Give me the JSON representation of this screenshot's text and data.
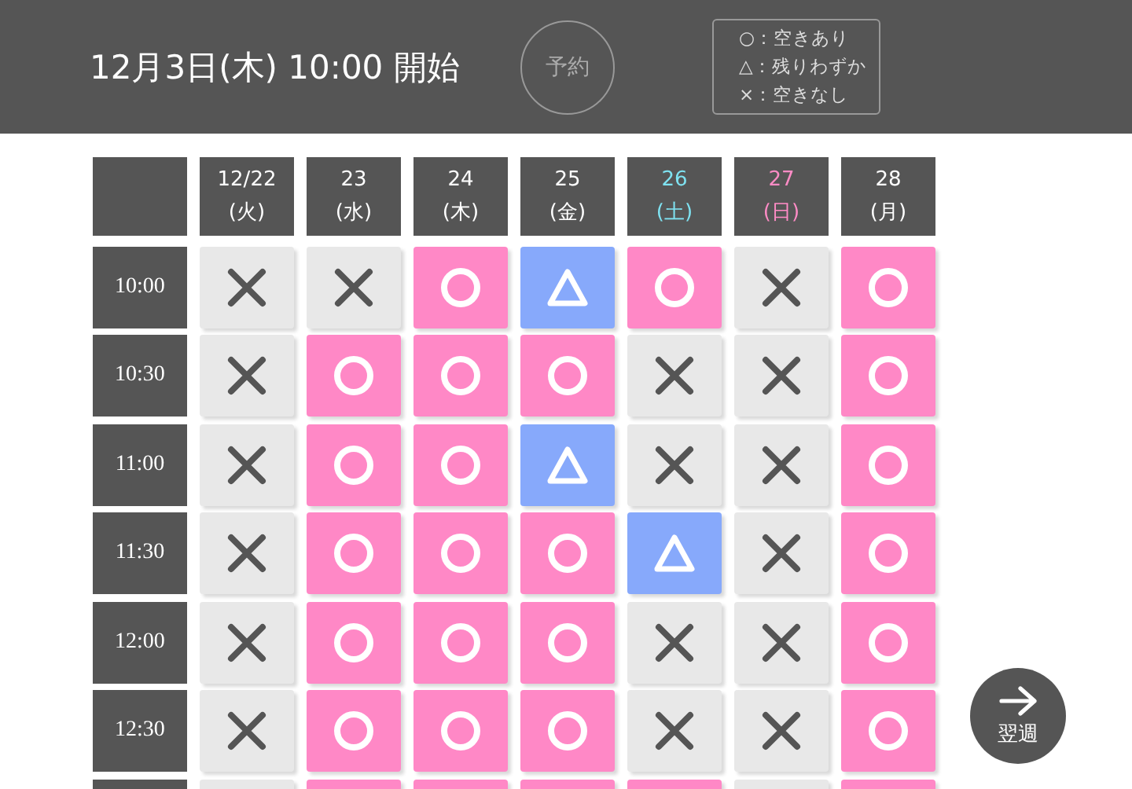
{
  "header": {
    "title": "12月3日(木) 10:00 開始",
    "reserve_button": "予約",
    "legend": [
      "○：空きあり",
      "△：残りわずか",
      "×：空きなし"
    ]
  },
  "days": [
    {
      "date": "12/22",
      "weekday": "(火)",
      "kind": "weekday"
    },
    {
      "date": "23",
      "weekday": "(水)",
      "kind": "weekday"
    },
    {
      "date": "24",
      "weekday": "(木)",
      "kind": "weekday"
    },
    {
      "date": "25",
      "weekday": "(金)",
      "kind": "weekday"
    },
    {
      "date": "26",
      "weekday": "(土)",
      "kind": "saturday"
    },
    {
      "date": "27",
      "weekday": "(日)",
      "kind": "sunday"
    },
    {
      "date": "28",
      "weekday": "(月)",
      "kind": "weekday"
    }
  ],
  "rows": [
    {
      "time": "10:00",
      "slots": [
        {
          "kind": "full"
        },
        {
          "kind": "full"
        },
        {
          "kind": "available"
        },
        {
          "kind": "few"
        },
        {
          "kind": "available"
        },
        {
          "kind": "full"
        },
        {
          "kind": "available"
        }
      ]
    },
    {
      "time": "10:30",
      "slots": [
        {
          "kind": "full"
        },
        {
          "kind": "available"
        },
        {
          "kind": "available"
        },
        {
          "kind": "available"
        },
        {
          "kind": "full"
        },
        {
          "kind": "full"
        },
        {
          "kind": "available"
        }
      ]
    },
    {
      "time": "11:00",
      "slots": [
        {
          "kind": "full"
        },
        {
          "kind": "available"
        },
        {
          "kind": "available"
        },
        {
          "kind": "few"
        },
        {
          "kind": "full"
        },
        {
          "kind": "full"
        },
        {
          "kind": "available"
        }
      ]
    },
    {
      "time": "11:30",
      "slots": [
        {
          "kind": "full"
        },
        {
          "kind": "available"
        },
        {
          "kind": "available"
        },
        {
          "kind": "available"
        },
        {
          "kind": "few"
        },
        {
          "kind": "full"
        },
        {
          "kind": "available"
        }
      ]
    },
    {
      "time": "12:00",
      "slots": [
        {
          "kind": "full"
        },
        {
          "kind": "available"
        },
        {
          "kind": "available"
        },
        {
          "kind": "available"
        },
        {
          "kind": "full"
        },
        {
          "kind": "full"
        },
        {
          "kind": "available"
        }
      ]
    },
    {
      "time": "12:30",
      "slots": [
        {
          "kind": "full"
        },
        {
          "kind": "available"
        },
        {
          "kind": "available"
        },
        {
          "kind": "available"
        },
        {
          "kind": "full"
        },
        {
          "kind": "full"
        },
        {
          "kind": "available"
        }
      ]
    },
    {
      "cut": true,
      "slots": [
        {
          "kind": "full"
        },
        {
          "kind": "available"
        },
        {
          "kind": "available"
        },
        {
          "kind": "available"
        },
        {
          "kind": "available"
        },
        {
          "kind": "full"
        },
        {
          "kind": "available"
        }
      ]
    }
  ],
  "next_week_button": "翌週"
}
